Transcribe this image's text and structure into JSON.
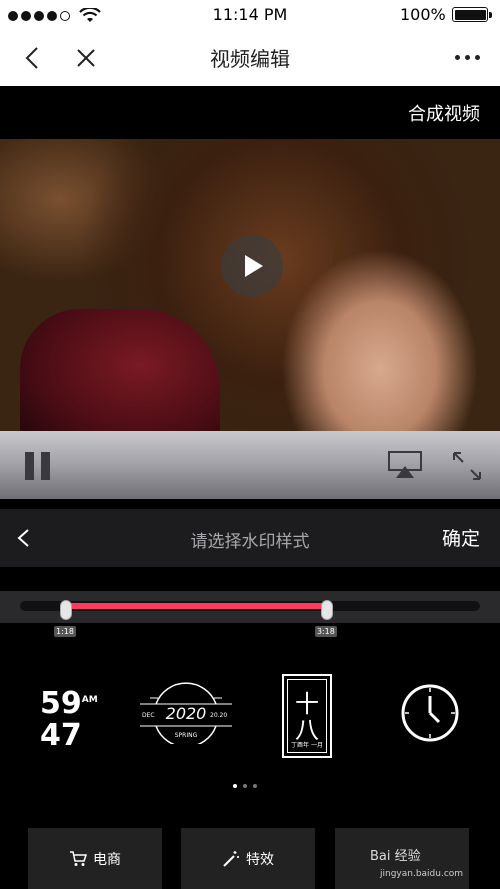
{
  "status_bar": {
    "time": "11:14 PM",
    "battery": "100%"
  },
  "nav": {
    "title": "视频编辑"
  },
  "compose_label": "合成视频",
  "watermark_panel": {
    "title": "请选择水印样式",
    "confirm": "确定",
    "range_start_label": "1:18",
    "range_end_label": "3:18",
    "range_start_fraction": 0.1,
    "range_end_fraction": 0.667
  },
  "styles": {
    "digital": {
      "hour": "59",
      "minute": "47",
      "ampm": "AM"
    },
    "spring": {
      "year": "2020",
      "left": "DEC",
      "right": "20.20",
      "word": "SPRING"
    },
    "lunar": {
      "top": "十",
      "bottom": "八",
      "sub": "丁酉年 一月"
    }
  },
  "buttons": [
    {
      "label": "电商",
      "icon": "cart-icon"
    },
    {
      "label": "特效",
      "icon": "magic-wand-icon"
    },
    {
      "label": "",
      "icon": "more-icon"
    }
  ],
  "pager": {
    "count": 3,
    "active": 0
  },
  "site_watermark": {
    "logo": "Bai 经验",
    "url": "jingyan.baidu.com"
  }
}
